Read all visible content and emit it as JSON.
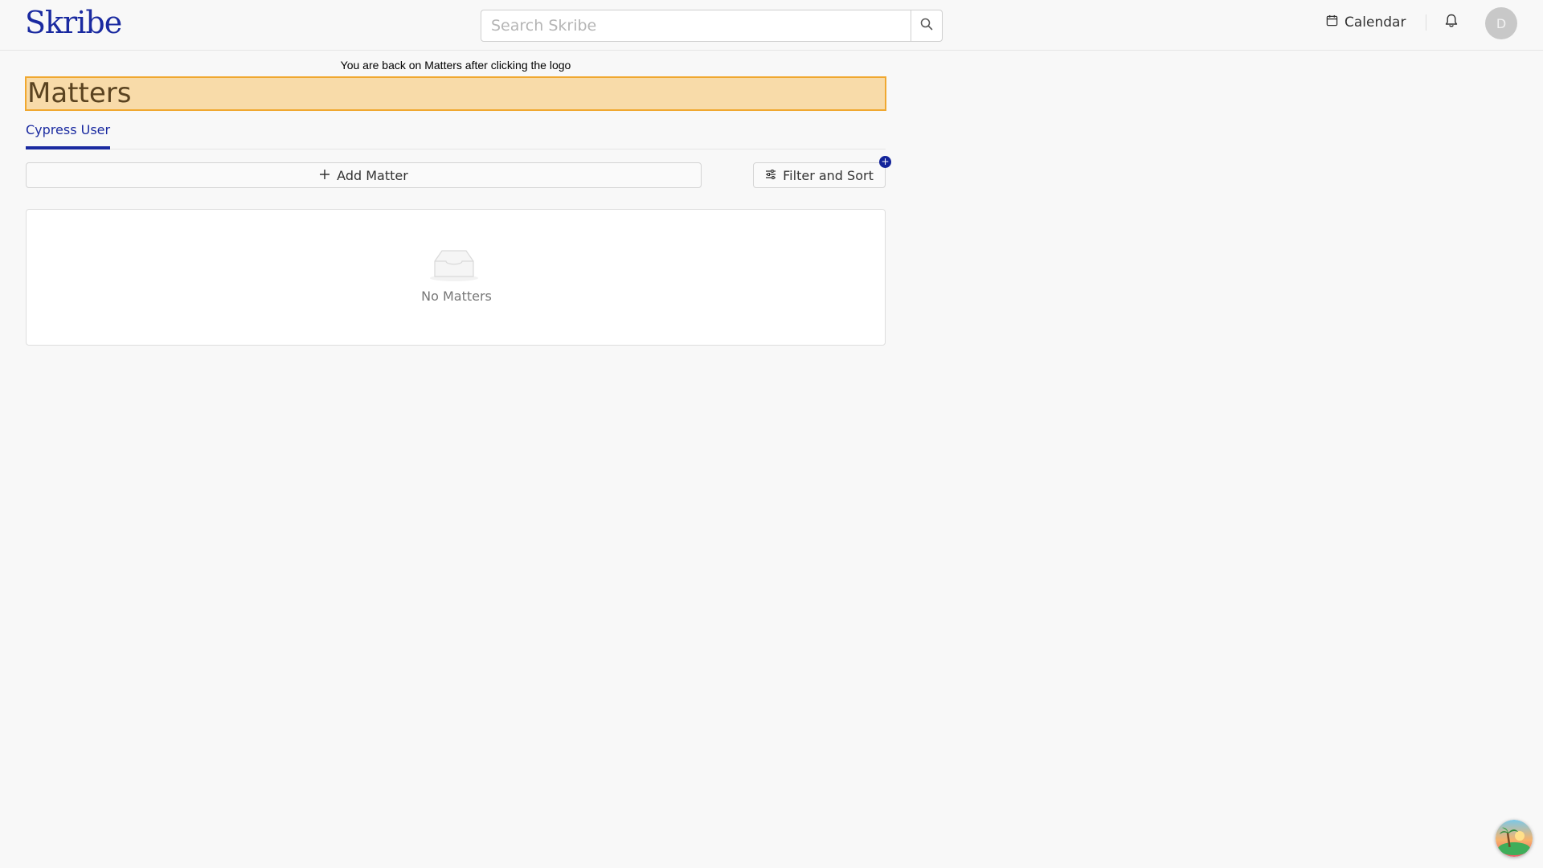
{
  "app": {
    "logo_text": "Skribe",
    "brand_color": "#1a2aa0"
  },
  "header": {
    "search": {
      "placeholder": "Search Skribe",
      "value": "",
      "icon": "search-icon"
    },
    "calendar_label": "Calendar",
    "calendar_icon": "calendar-icon",
    "notifications_icon": "bell-icon",
    "avatar_initial": "D"
  },
  "notice": "You are back on Matters after clicking the logo",
  "page": {
    "title": "Matters",
    "highlight_fill": "#f8dba9",
    "highlight_border": "#f0a830"
  },
  "tabs": [
    {
      "label": "Cypress User",
      "active": true
    }
  ],
  "toolbar": {
    "add_label": "Add Matter",
    "add_icon": "plus-icon",
    "filter_label": "Filter and Sort",
    "filter_icon": "sliders-icon",
    "filter_badge": "+"
  },
  "empty_state": {
    "icon": "inbox-icon",
    "text": "No Matters"
  },
  "floating_widget_icon": "island-icon"
}
